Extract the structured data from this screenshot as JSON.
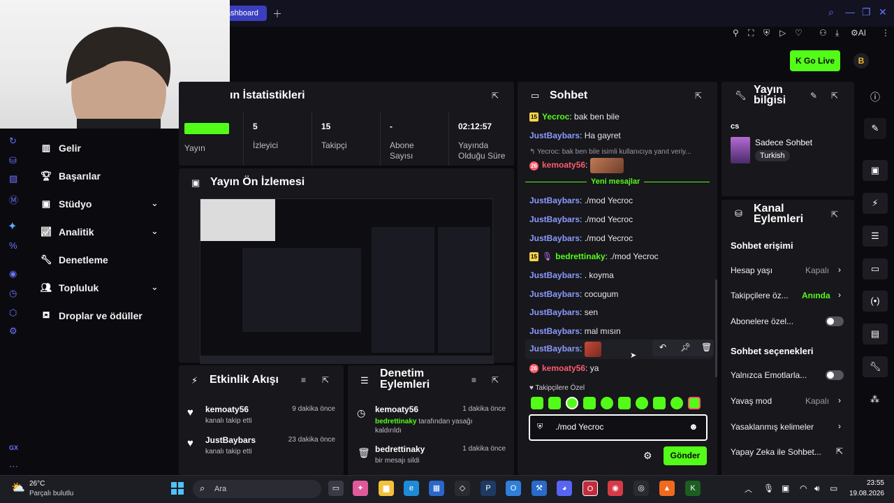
{
  "browser": {
    "tab_label": "ashboard",
    "toolbar_ai": "AI"
  },
  "header": {
    "go_live": "Go Live"
  },
  "sidebar": {
    "items": [
      {
        "label": "Gelir"
      },
      {
        "label": "Başarılar"
      },
      {
        "label": "Stüdyo"
      },
      {
        "label": "Analitik"
      },
      {
        "label": "Denetleme"
      },
      {
        "label": "Topluluk"
      },
      {
        "label": "Droplar ve ödüller"
      }
    ],
    "gx": "GX"
  },
  "stats": {
    "title": "ın İstatistikleri",
    "items": [
      {
        "value": "",
        "label": "Yayın"
      },
      {
        "value": "5",
        "label": "İzleyici"
      },
      {
        "value": "15",
        "label": "Takipçi"
      },
      {
        "value": "-",
        "label": "Abone Sayısı"
      },
      {
        "value": "02:12:57",
        "label": "Yayında Olduğu Süre"
      }
    ]
  },
  "preview": {
    "title": "Yayın Ön İzlemesi"
  },
  "events": {
    "title": "Etkinlik Akışı",
    "items": [
      {
        "name": "kemoaty56",
        "sub": "kanalı takip etti",
        "time": "9 dakika önce"
      },
      {
        "name": "JustBaybars",
        "sub": "kanalı takip etti",
        "time": "23 dakika önce"
      }
    ]
  },
  "modlog": {
    "title": "Denetim Eylemleri",
    "items": [
      {
        "name": "kemoaty56",
        "sub_user": "bedrettinaky",
        "sub": " tarafından yasağı kaldırıldı",
        "time": "1 dakika önce"
      },
      {
        "name": "bedrettinaky",
        "sub": "bir mesajı sildi",
        "time": "1 dakika önce"
      }
    ]
  },
  "chat": {
    "title": "Sohbet",
    "messages": [
      {
        "user": "Yecroc",
        "text": " bak ben bile",
        "badge": "15"
      },
      {
        "user": "JustBaybars",
        "text": " Ha gayret"
      },
      {
        "reply": "Yecroc: bak ben bile isimli kullanıcıya yanıt veriy..."
      },
      {
        "user": "kemoaty56",
        "text": ""
      },
      {
        "divider": "Yeni mesajlar"
      },
      {
        "user": "JustBaybars",
        "text": " ./mod Yecroc"
      },
      {
        "user": "JustBaybars",
        "text": " ./mod Yecroc"
      },
      {
        "user": "JustBaybars",
        "text": " ./mod Yecroc"
      },
      {
        "user": "bedrettinaky",
        "text": " ./mod Yecroc",
        "badge": "15"
      },
      {
        "user": "JustBaybars",
        "text": " . koyma"
      },
      {
        "user": "JustBaybars",
        "text": " cocugum"
      },
      {
        "user": "JustBaybars",
        "text": " sen"
      },
      {
        "user": "JustBaybars",
        "text": " mal mısın"
      },
      {
        "user": "JustBaybars",
        "text": ""
      },
      {
        "user": "kemoaty56",
        "text": " ya"
      }
    ],
    "followers_only": "Takipçilere Özel",
    "input_value": "./mod Yecroc",
    "send": "Gönder"
  },
  "stream_info": {
    "title": "Yayın bilgisi",
    "stream_title": "cs",
    "category": "Sadece Sohbet",
    "language": "Turkish"
  },
  "channel_actions": {
    "title": "Kanal Eylemleri",
    "chat_access": "Sohbet erişimi",
    "rows_access": [
      {
        "label": "Hesap yaşı",
        "value": "Kapalı"
      },
      {
        "label": "Takipçilere öz...",
        "value": "Anında"
      },
      {
        "label": "Abonelere özel...",
        "value": ""
      }
    ],
    "chat_options": "Sohbet seçenekleri",
    "rows_options": [
      {
        "label": "Yalnızca Emotlarla...",
        "value": ""
      },
      {
        "label": "Yavaş mod",
        "value": "Kapalı"
      },
      {
        "label": "Yasaklanmış kelimeler",
        "value": ""
      },
      {
        "label": "Yapay Zeka ile Sohbet...",
        "value": ""
      }
    ]
  },
  "taskbar": {
    "temp": "26°C",
    "weather": "Parçalı bulutlu",
    "search": "Ara",
    "time": "23:55",
    "date": "19.08.2026"
  },
  "colors": {
    "accent": "#53fc18",
    "panel": "#17171c",
    "user_blue": "#8b9bff",
    "user_red": "#ff5b6b"
  }
}
